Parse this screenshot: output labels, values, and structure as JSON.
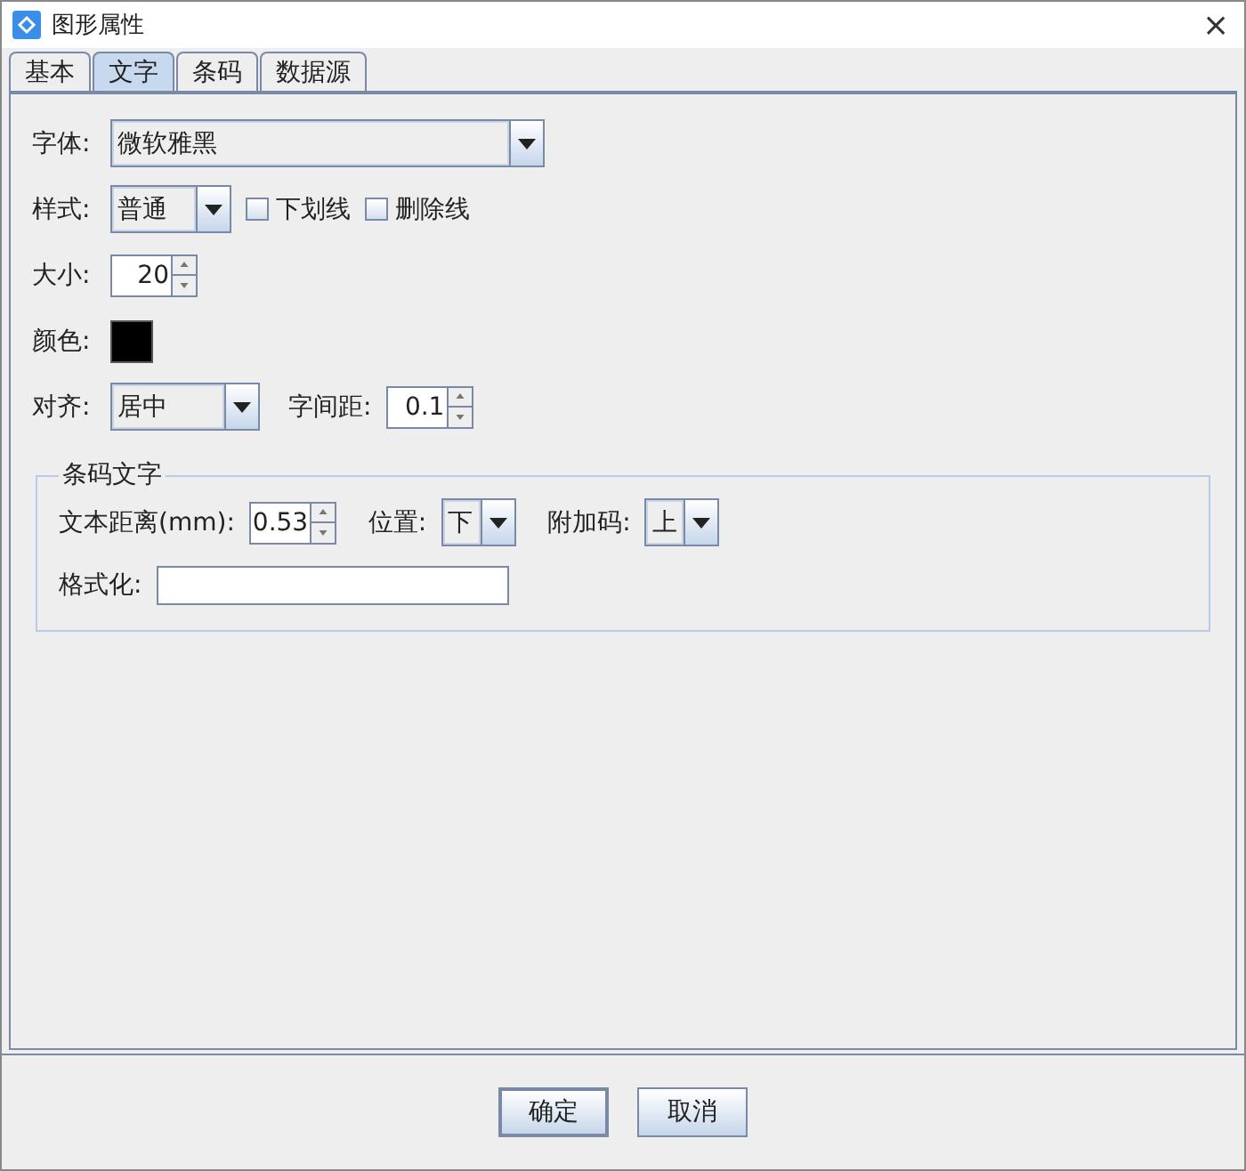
{
  "window": {
    "title": "图形属性",
    "close": "×"
  },
  "tabs": [
    {
      "label": "基本",
      "selected": false
    },
    {
      "label": "文字",
      "selected": true
    },
    {
      "label": "条码",
      "selected": false
    },
    {
      "label": "数据源",
      "selected": false
    }
  ],
  "font": {
    "label": "字体:",
    "value": "微软雅黑"
  },
  "style": {
    "label": "样式:",
    "value": "普通",
    "options": [
      {
        "label": "下划线",
        "checked": false
      },
      {
        "label": "删除线",
        "checked": false
      }
    ]
  },
  "size": {
    "label": "大小:",
    "value": "20"
  },
  "color": {
    "label": "颜色:",
    "color": "#000000"
  },
  "align": {
    "label": "对齐:",
    "value": "居中",
    "spacing_label": "字间距:",
    "spacing": "0.1"
  },
  "barcode_text": {
    "title": "条码文字",
    "distance_label": "文本距离(mm):",
    "distance": "0.53",
    "position_label": "位置:",
    "position": "下",
    "addon_label": "附加码:",
    "addon": "上",
    "format_label": "格式化:"
  },
  "buttons": [
    "确定",
    "取消"
  ]
}
